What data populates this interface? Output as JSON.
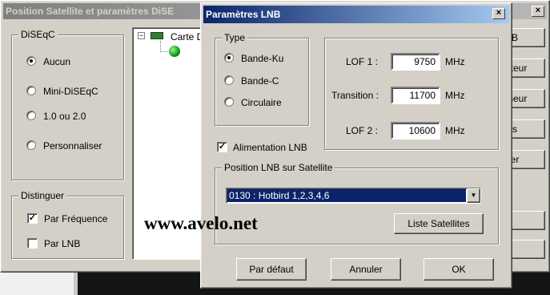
{
  "background_window": {
    "title": "Position Satellite et paramètres DiSE",
    "diseqc": {
      "legend": "DiSEqC",
      "options": [
        "Aucun",
        "Mini-DiSEqC",
        "1.0 ou 2.0",
        "Personnaliser"
      ],
      "selected": "Aucun"
    },
    "distinguer": {
      "legend": "Distinguer",
      "par_frequence": {
        "label": "Par Fréquence",
        "checked": true
      },
      "par_lnb": {
        "label": "Par LNB",
        "checked": false
      }
    },
    "tree": {
      "root_label": "Carte D"
    },
    "side_buttons": [
      "B",
      "tateur",
      "nneur",
      "s",
      "er"
    ]
  },
  "lnb_dialog": {
    "title": "Paramètres LNB",
    "close_glyph": "×",
    "type": {
      "legend": "Type",
      "options": [
        "Bande-Ku",
        "Bande-C",
        "Circulaire"
      ],
      "selected": "Bande-Ku"
    },
    "lof1": {
      "label": "LOF 1 :",
      "value": "9750",
      "unit": "MHz"
    },
    "transition": {
      "label": "Transition :",
      "value": "11700",
      "unit": "MHz"
    },
    "lof2": {
      "label": "LOF 2 :",
      "value": "10600",
      "unit": "MHz"
    },
    "alimentation": {
      "label": "Alimentation LNB",
      "checked": true
    },
    "position": {
      "legend": "Position LNB sur Satellite",
      "selected": "0130 : Hotbird 1,2,3,4,6",
      "list_button": "Liste Satellites"
    },
    "buttons": {
      "default": "Par défaut",
      "cancel": "Annuler",
      "ok": "OK"
    }
  },
  "watermark": "www.avelo.net",
  "colors": {
    "face": "#d4d0c8",
    "title_active": "#0a246a",
    "selection": "#0a246a"
  }
}
